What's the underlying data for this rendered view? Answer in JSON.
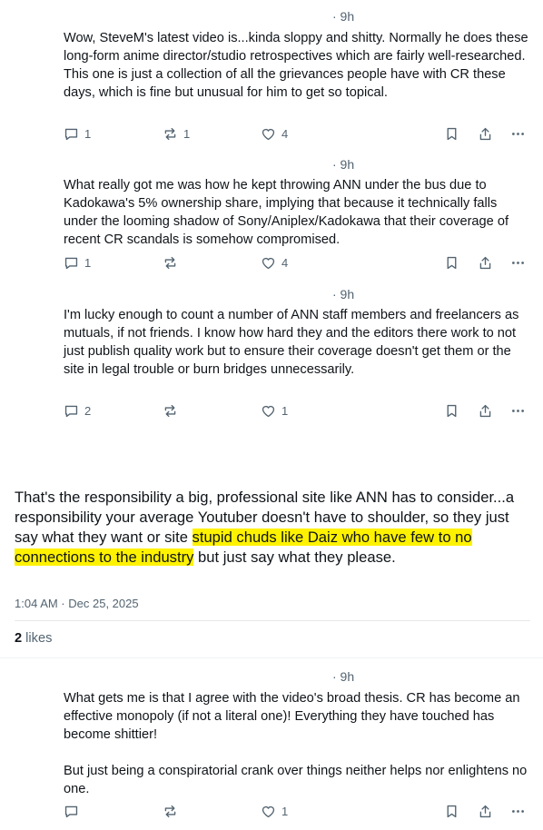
{
  "posts": [
    {
      "time": "· 9h",
      "lines": [
        "Wow, SteveM's latest video is...kinda sloppy and shitty.  Normally he does these long-form anime director/studio retrospectives which are fairly well-researched.",
        "This one is just a collection of all the grievances people have with CR these days, which is fine but unusual for him to get so topical."
      ],
      "replies": "1",
      "reposts": "1",
      "likes": "4"
    },
    {
      "time": "· 9h",
      "lines": [
        "What really got me was how he kept throwing ANN under the bus due to Kadokawa's 5% ownership share, implying that because it technically falls under the looming shadow of Sony/Aniplex/Kadokawa that their coverage of recent CR scandals is somehow compromised."
      ],
      "replies": "1",
      "reposts": "",
      "likes": "4"
    },
    {
      "time": "· 9h",
      "lines": [
        "I'm lucky enough to count a number of ANN staff members and freelancers as mutuals, if not friends.  I know how hard they and the editors there work to not just publish quality work but to ensure their coverage doesn't get them or the site in legal trouble or burn bridges unnecessarily."
      ],
      "replies": "2",
      "reposts": "",
      "likes": "1"
    }
  ],
  "main_post": {
    "text_before": "That's the responsibility a big, professional site like ANN has to consider...a responsibility your average Youtuber doesn't have to shoulder, so they just say what they want or site ",
    "text_highlight": "stupid chuds like Daiz who have few to no connections to the industry",
    "text_after": " but just say what they please.",
    "timestamp": "1:04 AM · Dec 25, 2025",
    "likes_count": "2",
    "likes_label": " likes",
    "highlight_color": "#fff200"
  },
  "reply": {
    "time": "· 9h",
    "lines": [
      "What gets me is that I agree with the video's broad thesis.  CR has become an effective monopoly (if not a literal one)! Everything they have touched has become shittier!",
      "",
      "But just being a conspiratorial crank over things neither helps nor enlightens no one."
    ],
    "replies": "",
    "reposts": "",
    "likes": "1"
  },
  "icons": [
    "reply-icon",
    "repost-icon",
    "like-icon",
    "bookmark-icon",
    "share-icon",
    "more-icon"
  ],
  "colors": {
    "text": "#0f1419",
    "muted": "#536471",
    "highlight": "#fff200"
  }
}
